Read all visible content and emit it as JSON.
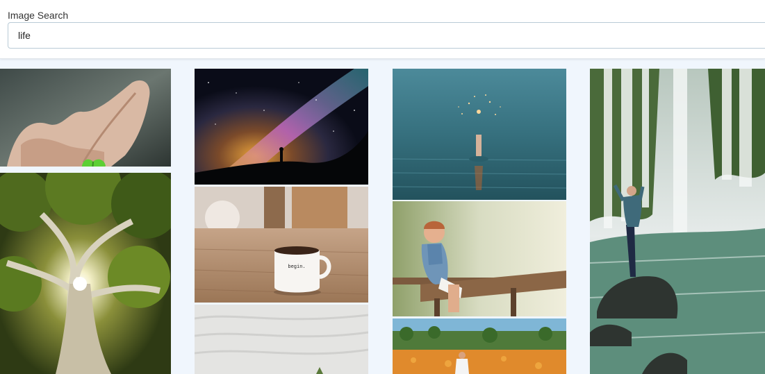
{
  "search": {
    "label": "Image Search",
    "value": "life"
  },
  "mug": {
    "text": "begin."
  },
  "colors": {
    "page_background": "#f0f6fd",
    "input_border": "#b9cbd6"
  }
}
